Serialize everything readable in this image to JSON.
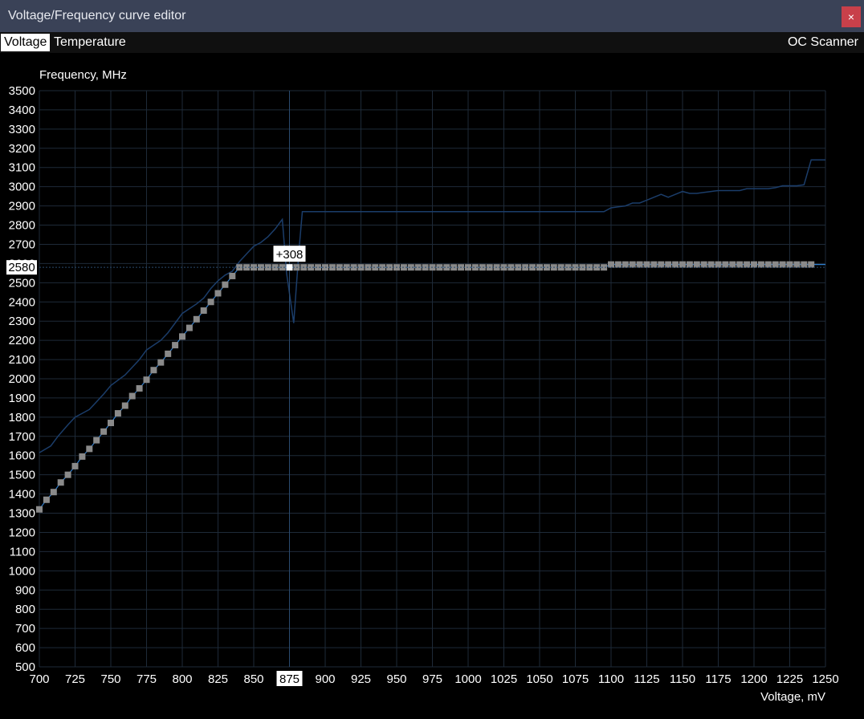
{
  "window": {
    "title": "Voltage/Frequency curve editor",
    "close_label": "×"
  },
  "tabs": [
    {
      "label": "Voltage",
      "active": true
    },
    {
      "label": "Temperature",
      "active": false
    }
  ],
  "oc_scanner_label": "OC Scanner",
  "colors": {
    "titlebar": "#3a4257",
    "close": "#c8404a",
    "grid": "#1e2a38",
    "curve_line": "#2f7fd1",
    "default_curve": "#1b3d6a",
    "point": "#8a8a8a",
    "selected_point": "#ffffff"
  },
  "chart_data": {
    "type": "line",
    "xlabel": "Voltage, mV",
    "ylabel": "Frequency, MHz",
    "xlim": [
      700,
      1250
    ],
    "ylim": [
      500,
      3500
    ],
    "x_ticks": [
      700,
      725,
      750,
      775,
      800,
      825,
      850,
      875,
      900,
      925,
      950,
      975,
      1000,
      1025,
      1050,
      1075,
      1100,
      1125,
      1150,
      1175,
      1200,
      1225,
      1250
    ],
    "y_ticks": [
      500,
      600,
      700,
      800,
      900,
      1000,
      1100,
      1200,
      1300,
      1400,
      1500,
      1600,
      1700,
      1800,
      1900,
      2000,
      2100,
      2200,
      2300,
      2400,
      2500,
      2600,
      2700,
      2800,
      2900,
      3000,
      3100,
      3200,
      3300,
      3400,
      3500
    ],
    "grid": true,
    "selected": {
      "voltage": 875,
      "frequency": 2580,
      "offset_label": "+308",
      "freq_label": "2580",
      "volt_label": "875"
    },
    "series": [
      {
        "role": "default_curve",
        "x": [
          700,
          708,
          713,
          720,
          725,
          730,
          735,
          740,
          745,
          750,
          760,
          770,
          775,
          785,
          790,
          800,
          810,
          815,
          820,
          825,
          830,
          835,
          840,
          845,
          850,
          855,
          860,
          865,
          868,
          870,
          873,
          878,
          880,
          882,
          884,
          1095,
          1100,
          1105,
          1110,
          1115,
          1120,
          1125,
          1130,
          1135,
          1140,
          1145,
          1150,
          1155,
          1160,
          1165,
          1170,
          1175,
          1190,
          1195,
          1200,
          1205,
          1210,
          1215,
          1220,
          1225,
          1230,
          1235,
          1240,
          1250
        ],
        "y": [
          1615,
          1650,
          1700,
          1760,
          1800,
          1820,
          1840,
          1880,
          1920,
          1965,
          2020,
          2100,
          2150,
          2200,
          2240,
          2340,
          2390,
          2420,
          2470,
          2510,
          2540,
          2560,
          2610,
          2650,
          2690,
          2710,
          2740,
          2780,
          2810,
          2830,
          2550,
          2290,
          2500,
          2700,
          2870,
          2870,
          2890,
          2895,
          2900,
          2915,
          2915,
          2930,
          2945,
          2960,
          2945,
          2960,
          2975,
          2965,
          2965,
          2970,
          2975,
          2980,
          2980,
          2990,
          2990,
          2990,
          2990,
          2995,
          3005,
          3005,
          3005,
          3010,
          3140,
          3140
        ]
      },
      {
        "role": "curve_points",
        "x": [
          700,
          705,
          710,
          715,
          720,
          725,
          730,
          735,
          740,
          745,
          750,
          755,
          760,
          765,
          770,
          775,
          780,
          785,
          790,
          795,
          800,
          805,
          810,
          815,
          820,
          825,
          830,
          835,
          840,
          845,
          850,
          855,
          860,
          865,
          870,
          875,
          880,
          885,
          890,
          895,
          900,
          905,
          910,
          915,
          920,
          925,
          930,
          935,
          940,
          945,
          950,
          955,
          960,
          965,
          970,
          975,
          980,
          985,
          990,
          995,
          1000,
          1005,
          1010,
          1015,
          1020,
          1025,
          1030,
          1035,
          1040,
          1045,
          1050,
          1055,
          1060,
          1065,
          1070,
          1075,
          1080,
          1085,
          1090,
          1095,
          1100,
          1105,
          1110,
          1115,
          1120,
          1125,
          1130,
          1135,
          1140,
          1145,
          1150,
          1155,
          1160,
          1165,
          1170,
          1175,
          1180,
          1185,
          1190,
          1195,
          1200,
          1205,
          1210,
          1215,
          1220,
          1225,
          1230,
          1235,
          1240,
          1250
        ],
        "y": [
          1320,
          1370,
          1410,
          1460,
          1500,
          1545,
          1595,
          1635,
          1680,
          1725,
          1770,
          1820,
          1860,
          1910,
          1950,
          1995,
          2045,
          2085,
          2130,
          2175,
          2220,
          2265,
          2310,
          2355,
          2400,
          2445,
          2490,
          2535,
          2580,
          2580,
          2580,
          2580,
          2580,
          2580,
          2580,
          2580,
          2580,
          2580,
          2580,
          2580,
          2580,
          2580,
          2580,
          2580,
          2580,
          2580,
          2580,
          2580,
          2580,
          2580,
          2580,
          2580,
          2580,
          2580,
          2580,
          2580,
          2580,
          2580,
          2580,
          2580,
          2580,
          2580,
          2580,
          2580,
          2580,
          2580,
          2580,
          2580,
          2580,
          2580,
          2580,
          2580,
          2580,
          2580,
          2580,
          2580,
          2580,
          2580,
          2580,
          2580,
          2595,
          2595,
          2595,
          2595,
          2595,
          2595,
          2595,
          2595,
          2595,
          2595,
          2595,
          2595,
          2595,
          2595,
          2595,
          2595,
          2595,
          2595,
          2595,
          2595,
          2595,
          2595,
          2595,
          2595,
          2595,
          2595,
          2595,
          2595,
          2595,
          2595
        ]
      }
    ]
  }
}
